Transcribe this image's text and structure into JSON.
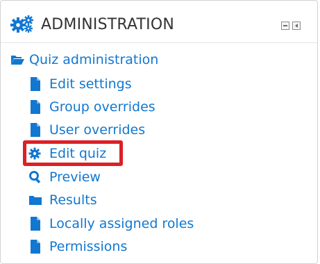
{
  "block": {
    "title": "ADMINISTRATION",
    "icon": "gears-icon",
    "controls": [
      {
        "name": "hide-block-button",
        "icon": "minus-box-icon"
      },
      {
        "name": "dock-block-button",
        "icon": "dock-arrow-icon"
      }
    ]
  },
  "tree": {
    "parent": {
      "label": "Quiz administration",
      "icon": "folder-open-icon"
    },
    "items": [
      {
        "label": "Edit settings",
        "icon": "file-icon"
      },
      {
        "label": "Group overrides",
        "icon": "file-icon"
      },
      {
        "label": "User overrides",
        "icon": "file-icon"
      },
      {
        "label": "Edit quiz",
        "icon": "gear-icon",
        "highlighted": true
      },
      {
        "label": "Preview",
        "icon": "magnifier-icon"
      },
      {
        "label": "Results",
        "icon": "folder-icon"
      },
      {
        "label": "Locally assigned roles",
        "icon": "file-icon"
      },
      {
        "label": "Permissions",
        "icon": "file-icon"
      }
    ]
  },
  "colors": {
    "link": "#1177d1",
    "icon": "#1177d1",
    "header_text": "#333333",
    "highlight_border": "#dd1f26"
  }
}
